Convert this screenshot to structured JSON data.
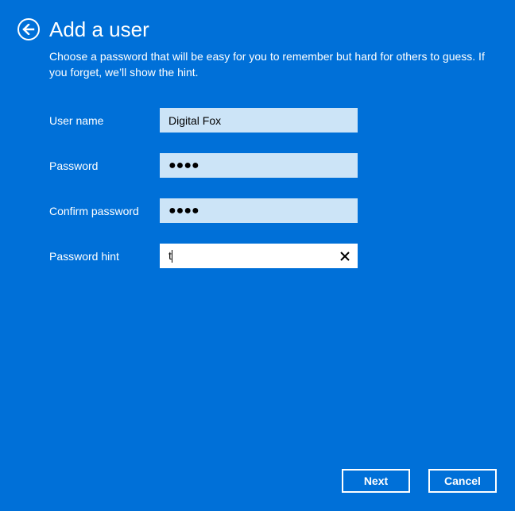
{
  "header": {
    "back_icon": "back-arrow-circle-icon",
    "title": "Add a user",
    "description": "Choose a password that will be easy for you to remember but hard for others to guess. If you forget, we’ll show the hint."
  },
  "form": {
    "fields": [
      {
        "label": "User name",
        "value": "Digital Fox",
        "type": "text"
      },
      {
        "label": "Password",
        "value": "●●●●",
        "type": "password"
      },
      {
        "label": "Confirm password",
        "value": "●●●●",
        "type": "password"
      },
      {
        "label": "Password hint",
        "value": "t",
        "type": "text",
        "focused": true,
        "clear_icon": "close-icon"
      }
    ]
  },
  "buttons": {
    "next": "Next",
    "cancel": "Cancel"
  },
  "colors": {
    "background": "#0070d8",
    "field_bg": "#cce4f7",
    "field_active_bg": "#ffffff",
    "text": "#ffffff"
  }
}
